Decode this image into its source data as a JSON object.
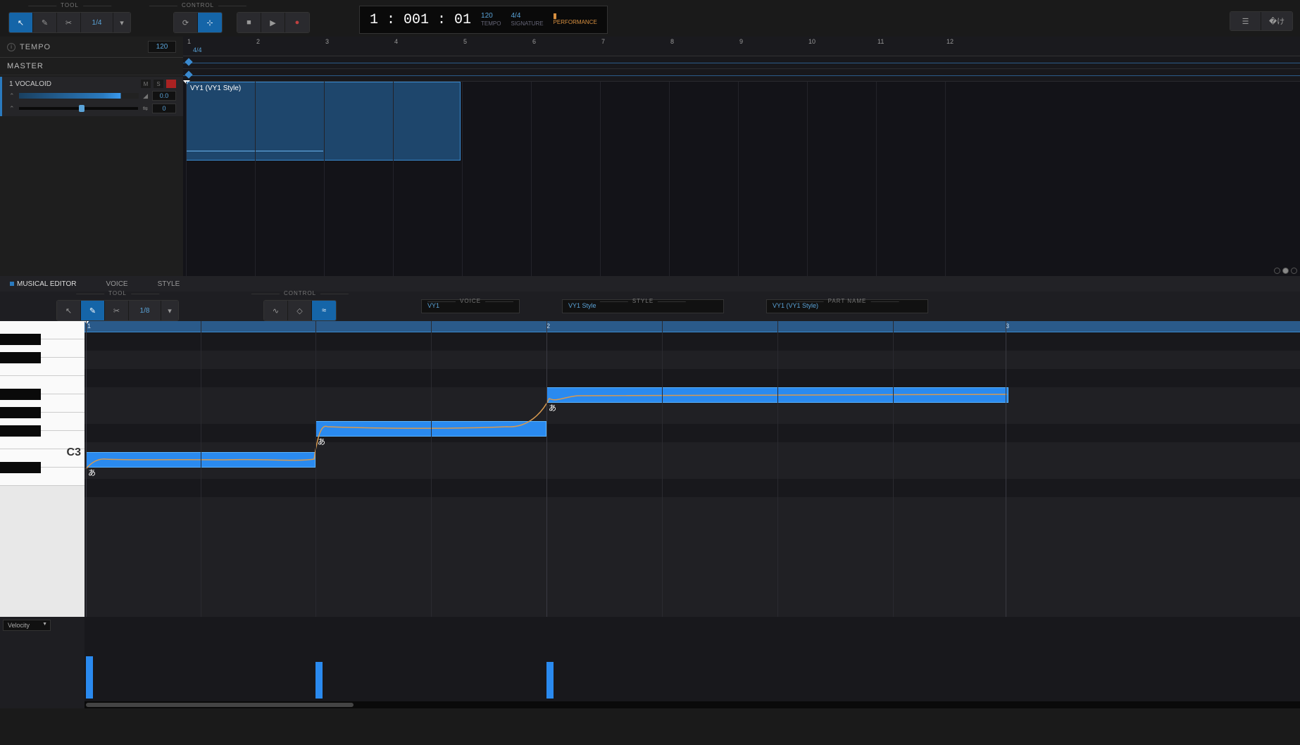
{
  "toolbar": {
    "tool_label": "TOOL",
    "control_label": "CONTROL",
    "quantize_top": "1/4",
    "quantize_editor": "1/8"
  },
  "transport": {
    "position": "1 : 001 : 01",
    "tempo_val": "120",
    "tempo_label": "TEMPO",
    "sig_val": "4/4",
    "sig_label": "SIGNATURE",
    "perf_label": "PERFORMANCE"
  },
  "left": {
    "tempo_label": "TEMPO",
    "tempo_bpm": "120",
    "master_label": "MASTER",
    "track_name": "1 VOCALOID",
    "mute": "M",
    "solo": "S",
    "vol": "0.0",
    "pan": "0"
  },
  "timeline": {
    "signature": "4/4",
    "bars": [
      "1",
      "2",
      "3",
      "4",
      "5",
      "6",
      "7",
      "8",
      "9",
      "10",
      "11",
      "12"
    ],
    "clip_name": "VY1 (VY1 Style)"
  },
  "editor": {
    "tab_main": "MUSICAL EDITOR",
    "tab_voice": "VOICE",
    "tab_style": "STYLE",
    "voice_label": "VOICE",
    "voice_val": "VY1",
    "style_label": "STYLE",
    "style_val": "VY1 Style",
    "partname_label": "PART NAME",
    "partname_val": "VY1 (VY1 Style)",
    "ruler": [
      "1",
      "2",
      "3"
    ],
    "c3_label": "C3",
    "lyric": "あ"
  },
  "velocity": {
    "selector": "Velocity"
  }
}
